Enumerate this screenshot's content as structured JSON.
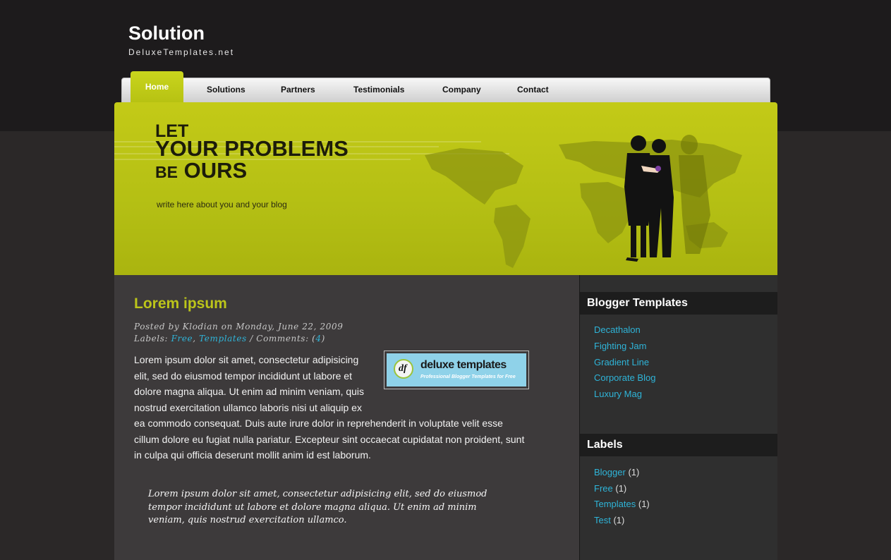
{
  "site": {
    "title": "Solution",
    "description": "DeluxeTemplates.net"
  },
  "nav": {
    "items": [
      "Home",
      "Solutions",
      "Partners",
      "Testimonials",
      "Company",
      "Contact"
    ]
  },
  "header": {
    "line1": "LET",
    "line2": "YOUR PROBLEMS",
    "line3_small": "BE",
    "line3_big": "OURS",
    "tagline": "write here about you and your blog"
  },
  "post": {
    "title": "Lorem ipsum",
    "posted_by": "Posted by",
    "author": "Klodian",
    "on": "on",
    "date": "Monday, June 22, 2009",
    "labels_prefix": "Labels:",
    "labels": [
      "Free",
      "Templates"
    ],
    "comments_prefix": "/ Comments:",
    "comments_count": "4",
    "image": {
      "logo_mark": "df",
      "logo_text": "deluxe templates",
      "logo_sub": "Professional Blogger Templates for Free"
    },
    "body": "Lorem ipsum dolor sit amet, consectetur adipisicing elit, sed do eiusmod tempor incididunt ut labore et dolore magna aliqua. Ut enim ad minim veniam, quis nostrud exercitation ullamco laboris nisi ut aliquip ex ea commodo consequat. Duis aute irure dolor in reprehenderit in voluptate velit esse cillum dolore eu fugiat nulla pariatur. Excepteur sint occaecat cupidatat non proident, sunt in culpa qui officia deserunt mollit anim id est laborum.",
    "blockquote": "Lorem ipsum dolor sit amet, consectetur adipisicing elit, sed do eiusmod tempor incididunt ut labore et dolore magna aliqua. Ut enim ad minim veniam, quis nostrud exercitation ullamco."
  },
  "sidebar": {
    "templates": {
      "title": "Blogger Templates",
      "links": [
        "Decathalon",
        "Fighting Jam",
        "Gradient Line",
        "Corporate Blog",
        "Luxury Mag"
      ]
    },
    "labels": {
      "title": "Labels",
      "items": [
        {
          "name": "Blogger",
          "count": "(1)"
        },
        {
          "name": "Free",
          "count": "(1)"
        },
        {
          "name": "Templates",
          "count": "(1)"
        },
        {
          "name": "Test",
          "count": "(1)"
        }
      ]
    }
  },
  "colors": {
    "accent": "#bcc51a",
    "link": "#2fb4d8",
    "header_green": "#b4bf14"
  }
}
